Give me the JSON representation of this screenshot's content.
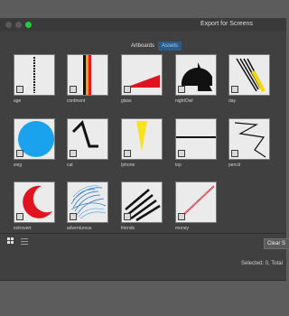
{
  "window": {
    "title": "Export for Screens",
    "traffic_lights": {
      "close_color": "#5a5a5a",
      "minimize_color": "#5a5a5a",
      "zoom_color": "#27c93f"
    }
  },
  "tabs": [
    {
      "label": "Artboards",
      "active": false
    },
    {
      "label": "Assets",
      "active": true
    }
  ],
  "assets": [
    {
      "label": "age"
    },
    {
      "label": "continent"
    },
    {
      "label": "glass"
    },
    {
      "label": "nightOwl"
    },
    {
      "label": "day"
    },
    {
      "label": "sing"
    },
    {
      "label": "cat"
    },
    {
      "label": "Iphone"
    },
    {
      "label": "top"
    },
    {
      "label": "pencil"
    },
    {
      "label": "extrovert"
    },
    {
      "label": "adventurous"
    },
    {
      "label": "friends"
    },
    {
      "label": "money"
    }
  ],
  "footer": {
    "clear_label": "Clear S",
    "status": "Selected: 0, Total"
  }
}
